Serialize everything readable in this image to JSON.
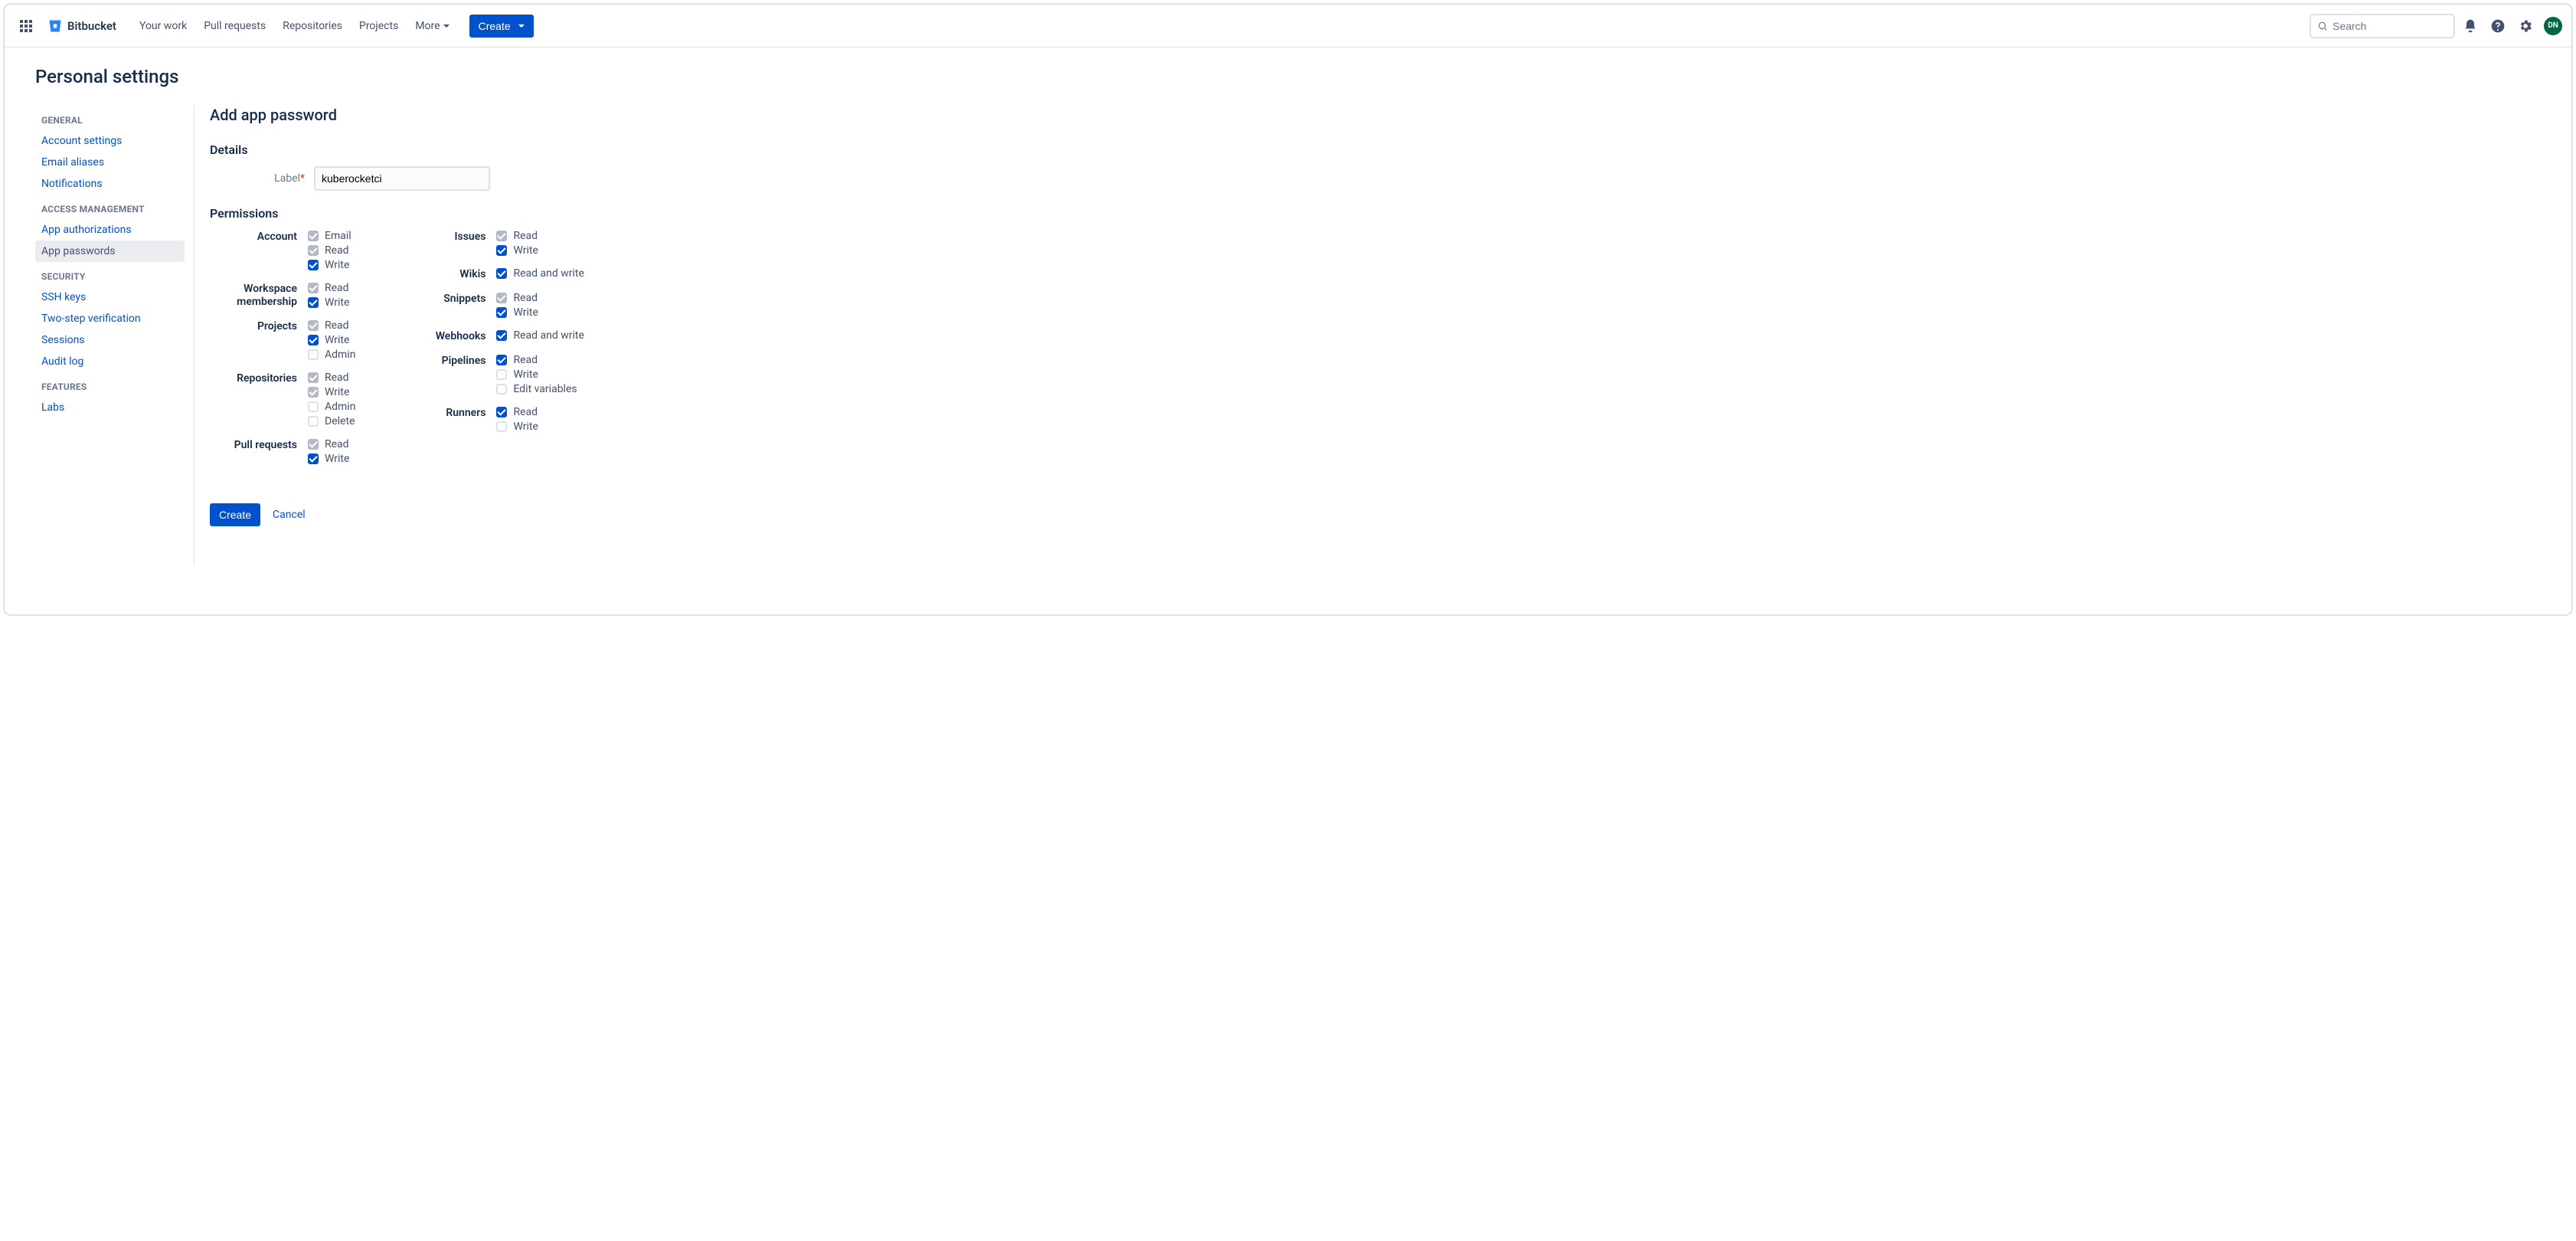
{
  "header": {
    "logo": "Bitbucket",
    "nav": [
      "Your work",
      "Pull requests",
      "Repositories",
      "Projects",
      "More"
    ],
    "create": "Create",
    "search_placeholder": "Search",
    "avatar": "DN"
  },
  "page_title": "Personal settings",
  "sidebar": {
    "groups": [
      {
        "label": "GENERAL",
        "items": [
          "Account settings",
          "Email aliases",
          "Notifications"
        ]
      },
      {
        "label": "ACCESS MANAGEMENT",
        "items": [
          "App authorizations",
          "App passwords"
        ]
      },
      {
        "label": "SECURITY",
        "items": [
          "SSH keys",
          "Two-step verification",
          "Sessions",
          "Audit log"
        ]
      },
      {
        "label": "FEATURES",
        "items": [
          "Labs"
        ]
      }
    ],
    "active": "App passwords"
  },
  "main": {
    "title": "Add app password",
    "details_heading": "Details",
    "label_field": "Label",
    "label_value": "kuberocketci",
    "permissions_heading": "Permissions",
    "perm_left": [
      {
        "title": "Account",
        "opts": [
          {
            "label": "Email",
            "checked": true,
            "disabled": true
          },
          {
            "label": "Read",
            "checked": true,
            "disabled": true
          },
          {
            "label": "Write",
            "checked": true,
            "disabled": false
          }
        ]
      },
      {
        "title": "Workspace membership",
        "opts": [
          {
            "label": "Read",
            "checked": true,
            "disabled": true
          },
          {
            "label": "Write",
            "checked": true,
            "disabled": false
          }
        ]
      },
      {
        "title": "Projects",
        "opts": [
          {
            "label": "Read",
            "checked": true,
            "disabled": true
          },
          {
            "label": "Write",
            "checked": true,
            "disabled": false
          },
          {
            "label": "Admin",
            "checked": false,
            "disabled": false
          }
        ]
      },
      {
        "title": "Repositories",
        "opts": [
          {
            "label": "Read",
            "checked": true,
            "disabled": true
          },
          {
            "label": "Write",
            "checked": true,
            "disabled": true
          },
          {
            "label": "Admin",
            "checked": false,
            "disabled": false
          },
          {
            "label": "Delete",
            "checked": false,
            "disabled": false
          }
        ]
      },
      {
        "title": "Pull requests",
        "opts": [
          {
            "label": "Read",
            "checked": true,
            "disabled": true
          },
          {
            "label": "Write",
            "checked": true,
            "disabled": false
          }
        ]
      }
    ],
    "perm_right": [
      {
        "title": "Issues",
        "opts": [
          {
            "label": "Read",
            "checked": true,
            "disabled": true
          },
          {
            "label": "Write",
            "checked": true,
            "disabled": false
          }
        ]
      },
      {
        "title": "Wikis",
        "opts": [
          {
            "label": "Read and write",
            "checked": true,
            "disabled": false
          }
        ]
      },
      {
        "title": "Snippets",
        "opts": [
          {
            "label": "Read",
            "checked": true,
            "disabled": true
          },
          {
            "label": "Write",
            "checked": true,
            "disabled": false
          }
        ]
      },
      {
        "title": "Webhooks",
        "opts": [
          {
            "label": "Read and write",
            "checked": true,
            "disabled": false
          }
        ]
      },
      {
        "title": "Pipelines",
        "opts": [
          {
            "label": "Read",
            "checked": true,
            "disabled": false
          },
          {
            "label": "Write",
            "checked": false,
            "disabled": false
          },
          {
            "label": "Edit variables",
            "checked": false,
            "disabled": false
          }
        ]
      },
      {
        "title": "Runners",
        "opts": [
          {
            "label": "Read",
            "checked": true,
            "disabled": false
          },
          {
            "label": "Write",
            "checked": false,
            "disabled": false
          }
        ]
      }
    ],
    "create_btn": "Create",
    "cancel": "Cancel"
  }
}
